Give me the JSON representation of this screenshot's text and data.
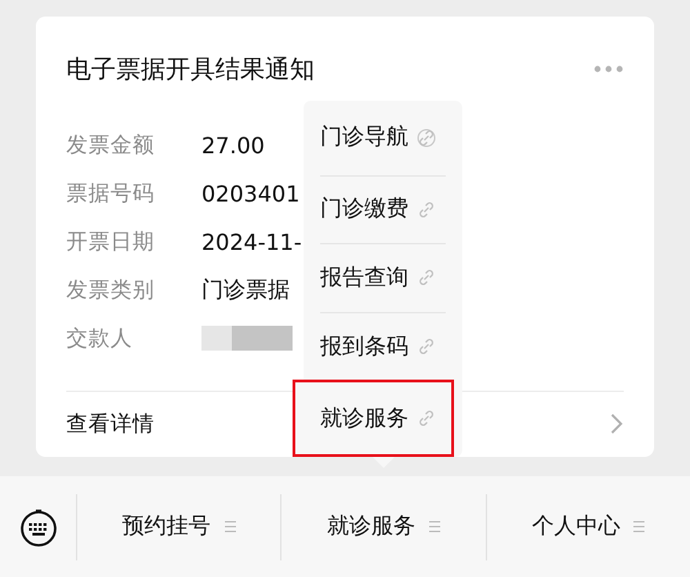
{
  "card": {
    "title": "电子票据开具结果通知",
    "fields": [
      {
        "label": "发票金额",
        "value": "27.00"
      },
      {
        "label": "票据号码",
        "value": "0203401"
      },
      {
        "label": "开票日期",
        "value": "2024-11-"
      },
      {
        "label": "发票类别",
        "value": "门诊票据"
      },
      {
        "label": "交款人",
        "redacted": true
      }
    ],
    "details_link": "查看详情"
  },
  "popup_menu": {
    "items": [
      {
        "label": "门诊导航",
        "highlighted": false
      },
      {
        "label": "门诊缴费",
        "highlighted": false
      },
      {
        "label": "报告查询",
        "highlighted": false
      },
      {
        "label": "报到条码",
        "highlighted": false
      },
      {
        "label": "就诊服务",
        "highlighted": true
      }
    ]
  },
  "bottom_menu": {
    "items": [
      {
        "label": "预约挂号"
      },
      {
        "label": "就诊服务"
      },
      {
        "label": "个人中心"
      }
    ]
  }
}
